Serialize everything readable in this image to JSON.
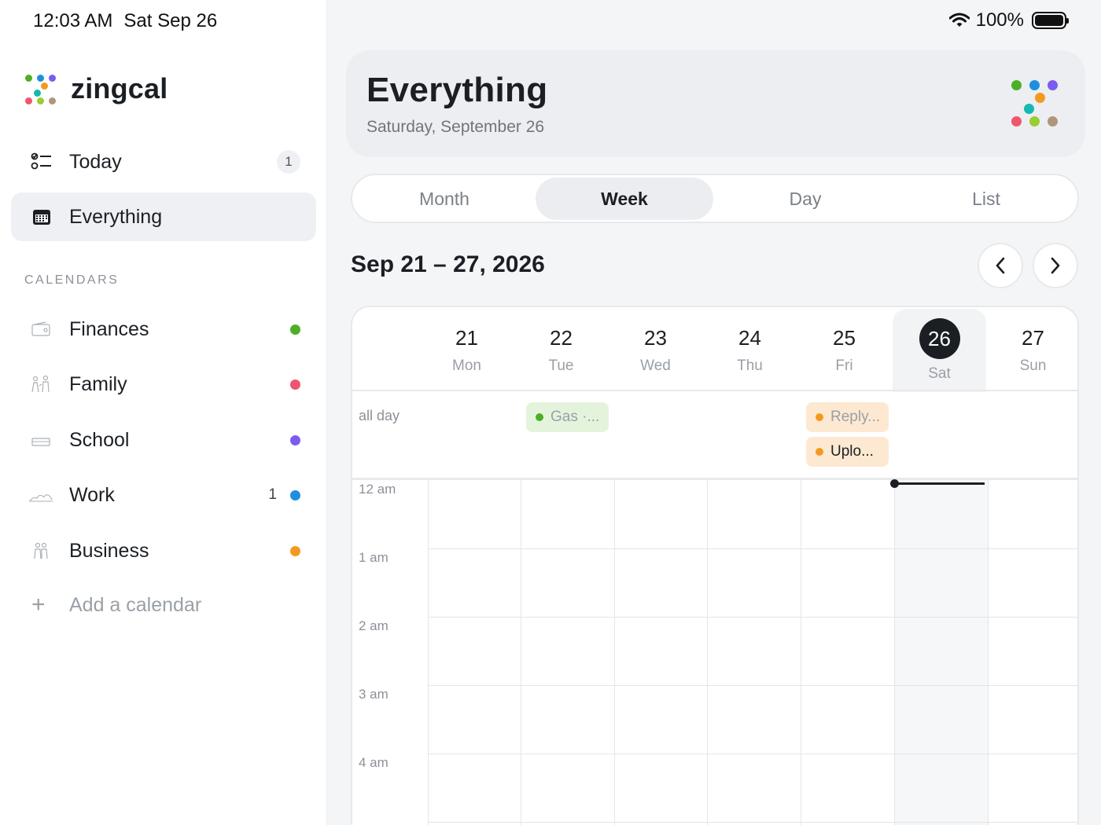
{
  "status_bar": {
    "time": "12:03 AM",
    "date": "Sat Sep 26",
    "battery": "100%"
  },
  "app": {
    "name": "zingcal"
  },
  "sidebar": {
    "today": {
      "label": "Today",
      "count": "1"
    },
    "everything": {
      "label": "Everything"
    },
    "section_title": "CALENDARS",
    "calendars": [
      {
        "label": "Finances",
        "color": "#4caf28",
        "icon": "wallet-icon",
        "count": ""
      },
      {
        "label": "Family",
        "color": "#f0556e",
        "icon": "family-icon",
        "count": ""
      },
      {
        "label": "School",
        "color": "#7b5cf0",
        "icon": "school-icon",
        "count": ""
      },
      {
        "label": "Work",
        "color": "#1e8fe0",
        "icon": "briefcase-icon",
        "count": "1"
      },
      {
        "label": "Business",
        "color": "#f39a1e",
        "icon": "business-icon",
        "count": ""
      }
    ],
    "add_calendar": "Add a calendar"
  },
  "header": {
    "title": "Everything",
    "subtitle": "Saturday, September 26"
  },
  "view_tabs": {
    "items": [
      "Month",
      "Week",
      "Day",
      "List"
    ],
    "selected": "Week"
  },
  "range": {
    "title": "Sep 21 – 27, 2026"
  },
  "week": {
    "days": [
      {
        "num": "21",
        "wd": "Mon"
      },
      {
        "num": "22",
        "wd": "Tue"
      },
      {
        "num": "23",
        "wd": "Wed"
      },
      {
        "num": "24",
        "wd": "Thu"
      },
      {
        "num": "25",
        "wd": "Fri"
      },
      {
        "num": "26",
        "wd": "Sat",
        "today": true
      },
      {
        "num": "27",
        "wd": "Sun"
      }
    ],
    "allday_label": "all day",
    "allday_events": [
      {
        "title": "Gas ·...",
        "day": "22",
        "color": "#4caf28",
        "bg": "#e4f4dc",
        "text_color": "#9aa0a6"
      },
      {
        "title": "Reply...",
        "day": "25",
        "color": "#f39a1e",
        "bg": "#fde9d1",
        "text_color": "#9aa0a6"
      },
      {
        "title": "Uplo...",
        "day": "25",
        "color": "#f39a1e",
        "bg": "#fde9d1",
        "text_color": "#1b1f24"
      }
    ],
    "hours": [
      "12 am",
      "1 am",
      "2 am",
      "3 am",
      "4 am"
    ]
  },
  "colors": {
    "accent": "#1b1f24",
    "logo_dots": [
      "#4caf28",
      "#1e8fe0",
      "#7b5cf0",
      "#f39a1e",
      "#16b8b0",
      "#f0556e",
      "#9acd32",
      "#b0967a"
    ]
  }
}
